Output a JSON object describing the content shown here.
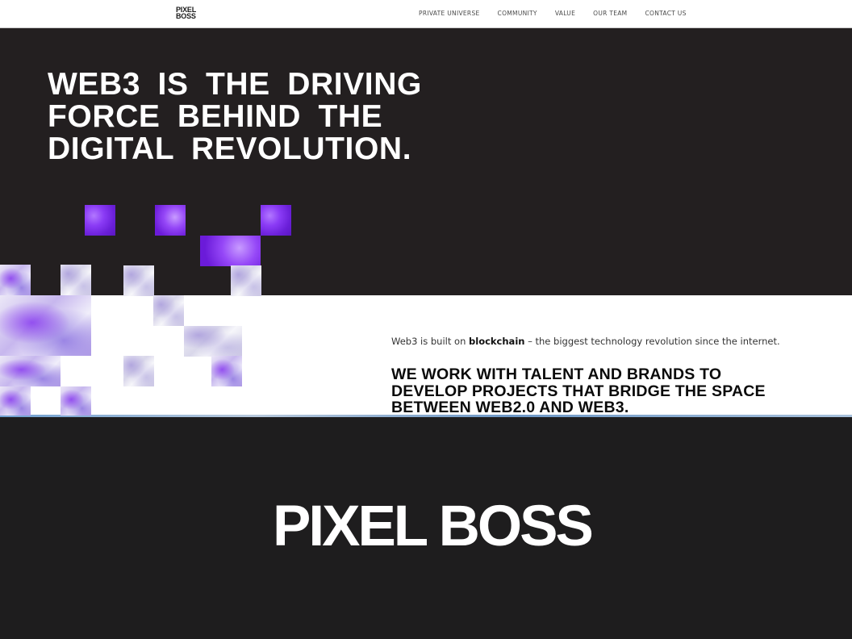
{
  "nav": {
    "logo_line1": "PIXEL",
    "logo_line2": "BOSS",
    "links": [
      "PRIVATE UNIVERSE",
      "COMMUNITY",
      "VALUE",
      "OUR TEAM",
      "CONTACT US"
    ]
  },
  "hero": {
    "heading_line1": "WEB3 IS THE DRIVING",
    "heading_line2": "FORCE BEHIND THE",
    "heading_line3": "DIGITAL REVOLUTION."
  },
  "intro": {
    "text_before": "Web3 is built on ",
    "text_bold": "blockchain",
    "text_after": " – the biggest technology revolution since the internet.",
    "heading_line1": "WE WORK WITH TALENT AND BRANDS TO",
    "heading_line2": "DEVELOP PROJECTS THAT BRIDGE THE SPACE",
    "heading_line3": "BETWEEN WEB2.0 AND WEB3."
  },
  "footer": {
    "logo_text": "PIXEL BOSS"
  },
  "colors": {
    "hero_bg": "#231f20",
    "footer_bg": "#1e1d1e",
    "accent_purple": "#8a3bf5"
  }
}
